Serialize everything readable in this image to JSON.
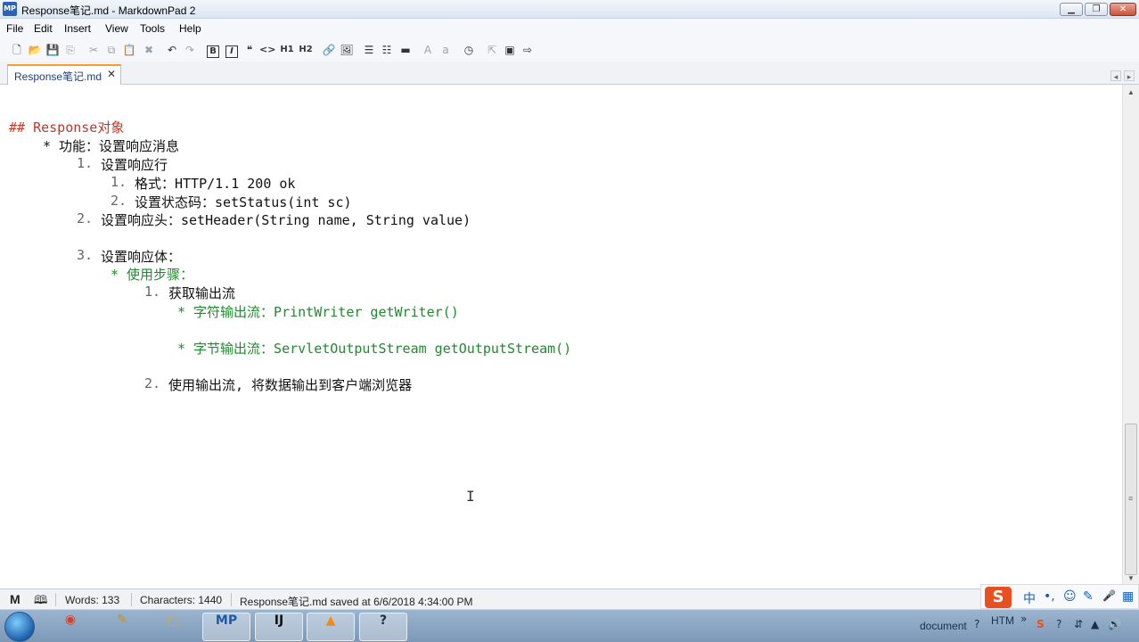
{
  "window": {
    "app_icon_text": "MP",
    "title": "Response笔记.md - MarkdownPad 2",
    "min_glyph": "▁",
    "max_glyph": "❐",
    "close_glyph": "✕"
  },
  "menu": [
    "File",
    "Edit",
    "Insert",
    "View",
    "Tools",
    "Help"
  ],
  "toolbar": {
    "new": "🗋",
    "open": "📂",
    "save": "💾",
    "save_all": "⎘",
    "cut": "✂",
    "copy": "⧉",
    "paste": "📋",
    "delete": "✖",
    "undo": "↶",
    "redo": "↷",
    "bold": "B",
    "italic": "I",
    "quote": "❝",
    "code": "<>",
    "h1": "H1",
    "h2": "H2",
    "link": "🔗",
    "image": "🖼",
    "ul": "☰",
    "ol": "☷",
    "hr": "▬",
    "upper": "A",
    "lower": "a",
    "timestamp": "◷",
    "preview": "⇱",
    "preview_window": "▣",
    "export": "⇨"
  },
  "tab": {
    "label": "Response笔记.md",
    "close": "✕"
  },
  "tab_nav": {
    "left": "◂",
    "right": "▸"
  },
  "editor": {
    "heading": "## Response对象",
    "l1": "* 功能：设置响应消息",
    "l2_num": "1.",
    "l2_text": "设置响应行",
    "l3_num": "1.",
    "l3_text": "格式：HTTP/1.1 200 ok",
    "l4_num": "2.",
    "l4_text": "设置状态码：setStatus(int sc)",
    "l5_num": "2.",
    "l5_text": "设置响应头：setHeader(String name, String value)",
    "l6_num": "3.",
    "l6_text": "设置响应体：",
    "l7": "* 使用步骤：",
    "l8_num": "1.",
    "l8_text": "获取输出流",
    "l9": "* 字符输出流：PrintWriter getWriter()",
    "l10": "* 字节输出流：ServletOutputStream getOutputStream()",
    "l11_num": "2.",
    "l11_text": "使用输出流, 将数据输出到客户端浏览器",
    "cursor": "I"
  },
  "scroll": {
    "up": "▲",
    "down": "▼",
    "grip": "≡"
  },
  "status": {
    "markdown_icon": "M",
    "book_icon": "🕮",
    "words": "Words: 133",
    "characters": "Characters: 1440",
    "saved": "Response笔记.md saved at 6/6/2018 4:34:00 PM"
  },
  "ime": {
    "logo": "S",
    "lang": "中",
    "punct": "•,",
    "emoji": "☺",
    "brush": "✎",
    "mic": "🎤",
    "grid": "▦"
  },
  "taskbar": {
    "apps": [
      {
        "name": "chrome",
        "glyph": "◉",
        "color": "#d8402a"
      },
      {
        "name": "pen",
        "glyph": "✎",
        "color": "#c98d2a"
      },
      {
        "name": "folder",
        "glyph": "🗀",
        "color": "#d9a92c"
      },
      {
        "name": "markdownpad",
        "glyph": "MP",
        "color": "#1f5aa6"
      },
      {
        "name": "intellij",
        "glyph": "IJ",
        "color": "#101010"
      },
      {
        "name": "vlc",
        "glyph": "▲",
        "color": "#f08a12"
      },
      {
        "name": "help",
        "glyph": "?",
        "color": "#1c2f4a"
      }
    ],
    "tray_document": "document",
    "tray_htm": "HTM",
    "tray_chevron": "»",
    "tray_icons": [
      "S",
      "?",
      "⇵",
      "▲",
      "🔊"
    ]
  }
}
